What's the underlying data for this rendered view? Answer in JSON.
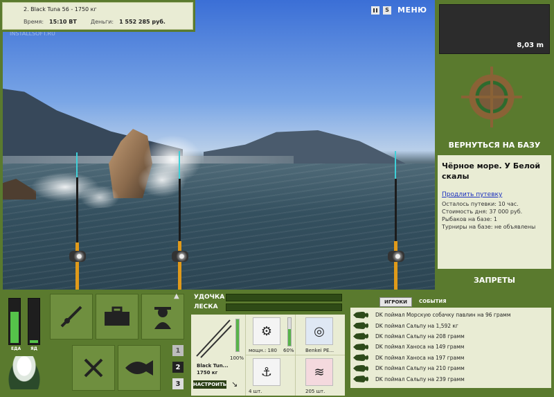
{
  "header": {
    "catch_title": "2. Black Tuna 56 - 1750 кг",
    "time_label": "Время:",
    "time_value": "15:10 ВТ",
    "money_label": "Деньги:",
    "money_value": "1 552 285 руб.",
    "menu_label": "МЕНЮ",
    "pause_icon": "pause-icon",
    "sound_label": "S"
  },
  "watermark": "INSTALLSOFT.RU",
  "depth": {
    "value": "8,03 m"
  },
  "right_panel": {
    "return_label": "ВЕРНУТЬСЯ НА БАЗУ",
    "place_title": "Чёрное море. У Белой скалы",
    "extend_link": "Продлить путевку",
    "lines": [
      "Осталось путевки: 10 час.",
      "Стоимость дня: 37 000 руб.",
      "Рыбаков на базе: 1",
      "Турниры на базе: не объявлены"
    ],
    "bans_label": "ЗАПРЕТЫ"
  },
  "status": {
    "food_label": "ЕДА",
    "poison_label": "ЯД",
    "food_level": 0.72,
    "poison_level": 0.06
  },
  "speed_buttons": [
    "1",
    "2",
    "3"
  ],
  "tackle": {
    "rod_label": "УДОЧКА",
    "line_label": "ЛЕСКА",
    "rod_name": "Black Tun...",
    "rod_weight": "1750 кг",
    "rod_percent": "100%",
    "setup_label": "НАСТРОИТЬ",
    "reel_power": "мощн.: 180",
    "reel_percent": "60%",
    "line_name": "Benkei PE...",
    "hook_count": "4 шт.",
    "bait_count": "205 шт."
  },
  "events": {
    "tab_players": "ИГРОКИ",
    "tab_events": "СОБЫТИЯ",
    "items": [
      "DK поймал Морскую собачку павлин на 96 грамм",
      "DK поймал Сальпу на 1,592 кг",
      "DK поймал Сальпу на 208 грамм",
      "DK поймал Ханоса на 149 грамм",
      "DK поймал Ханоса на 197 грамм",
      "DK поймал Сальпу на 210 грамм",
      "DK поймал Сальпу на 239 грамм"
    ]
  }
}
